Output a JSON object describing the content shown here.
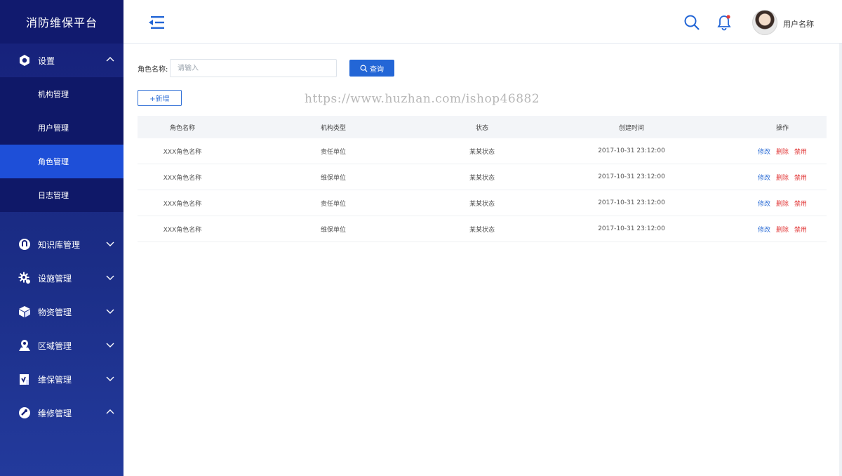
{
  "app": {
    "title": "消防维保平台"
  },
  "sidebar": {
    "settings": {
      "label": "设置",
      "icon": "gear-hex-icon"
    },
    "settings_items": [
      {
        "label": "机构管理",
        "active": false
      },
      {
        "label": "用户管理",
        "active": false
      },
      {
        "label": "角色管理",
        "active": true
      },
      {
        "label": "日志管理",
        "active": false
      }
    ],
    "groups": [
      {
        "label": "知识库管理",
        "icon": "knowledge-icon",
        "expanded": false
      },
      {
        "label": "设施管理",
        "icon": "cog-icon",
        "expanded": false
      },
      {
        "label": "物资管理",
        "icon": "box-icon",
        "expanded": false
      },
      {
        "label": "区域管理",
        "icon": "map-pin-icon",
        "expanded": false
      },
      {
        "label": "维保管理",
        "icon": "clipboard-icon",
        "expanded": false
      },
      {
        "label": "维修管理",
        "icon": "wrench-icon",
        "expanded": true
      }
    ]
  },
  "header": {
    "username": "用户名称"
  },
  "filter": {
    "label": "角色名称:",
    "placeholder": "请输入",
    "query_label": "查询"
  },
  "add_label": "+新增",
  "watermark": "https://www.huzhan.com/ishop46882",
  "table": {
    "columns": [
      "角色名称",
      "机构类型",
      "状态",
      "创建时间",
      "操作"
    ],
    "rows": [
      {
        "name": "XXX角色名称",
        "type": "责任单位",
        "status": "某某状态",
        "time": "2017-10-31  23:12:00"
      },
      {
        "name": "XXX角色名称",
        "type": "维保单位",
        "status": "某某状态",
        "time": "2017-10-31  23:12:00"
      },
      {
        "name": "XXX角色名称",
        "type": "责任单位",
        "status": "某某状态",
        "time": "2017-10-31  23:12:00"
      },
      {
        "name": "XXX角色名称",
        "type": "维保单位",
        "status": "某某状态",
        "time": "2017-10-31  23:12:00"
      }
    ],
    "actions": {
      "edit": "修改",
      "delete": "删除",
      "disable": "禁用"
    }
  },
  "colors": {
    "sidebar": "#16207a",
    "active": "#1e4fd8",
    "primary": "#2366d6",
    "danger": "#e23a3a"
  }
}
